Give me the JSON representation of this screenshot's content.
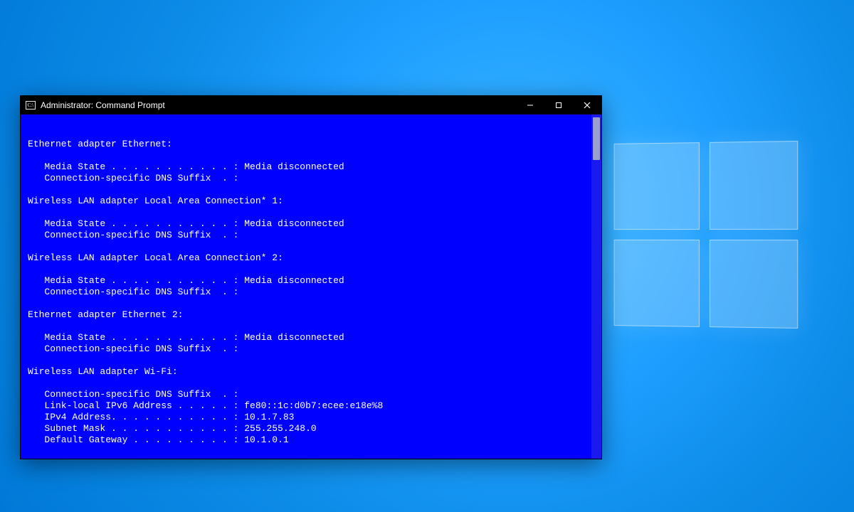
{
  "window": {
    "title": "Administrator: Command Prompt"
  },
  "terminal": {
    "lines": [
      "",
      "Ethernet adapter Ethernet:",
      "",
      "   Media State . . . . . . . . . . . : Media disconnected",
      "   Connection-specific DNS Suffix  . :",
      "",
      "Wireless LAN adapter Local Area Connection* 1:",
      "",
      "   Media State . . . . . . . . . . . : Media disconnected",
      "   Connection-specific DNS Suffix  . :",
      "",
      "Wireless LAN adapter Local Area Connection* 2:",
      "",
      "   Media State . . . . . . . . . . . : Media disconnected",
      "   Connection-specific DNS Suffix  . :",
      "",
      "Ethernet adapter Ethernet 2:",
      "",
      "   Media State . . . . . . . . . . . : Media disconnected",
      "   Connection-specific DNS Suffix  . :",
      "",
      "Wireless LAN adapter Wi-Fi:",
      "",
      "   Connection-specific DNS Suffix  . :",
      "   Link-local IPv6 Address . . . . . : fe80::1c:d0b7:ecee:e18e%8",
      "   IPv4 Address. . . . . . . . . . . : 10.1.7.83",
      "   Subnet Mask . . . . . . . . . . . : 255.255.248.0",
      "   Default Gateway . . . . . . . . . : 10.1.0.1",
      ""
    ]
  }
}
